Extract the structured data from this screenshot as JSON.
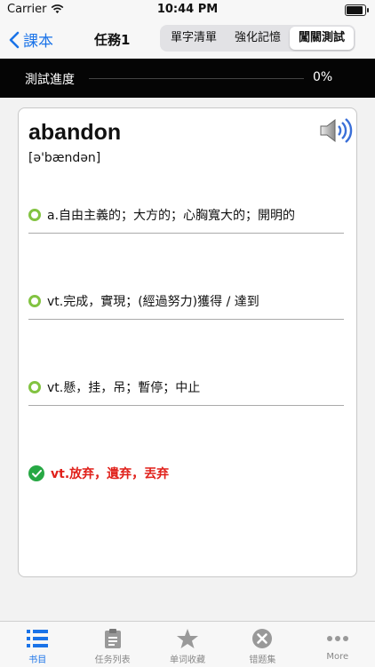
{
  "status": {
    "carrier": "Carrier",
    "time": "10:44 PM",
    "battery_level": 1.0
  },
  "navbar": {
    "back_label": "課本",
    "title": "任務1",
    "segments": [
      {
        "label": "單字清單",
        "active": false
      },
      {
        "label": "強化記憶",
        "active": false
      },
      {
        "label": "闖關測試",
        "active": true
      }
    ]
  },
  "progress": {
    "label": "測試進度",
    "value_text": "0%",
    "value": 0
  },
  "card": {
    "word": "abandon",
    "phonetic": "[ə'bændən]",
    "options": [
      {
        "text": "a.自由主義的；大方的；心胸寬大的；開明的",
        "correct": false
      },
      {
        "text": "vt.完成，實現；(經過努力)獲得 / 達到",
        "correct": false
      },
      {
        "text": "vt.懸，挂，吊；暫停；中止",
        "correct": false
      },
      {
        "text": "vt.放弃，遺弃，丟弃",
        "correct": true
      }
    ]
  },
  "tabs": [
    {
      "label": "书目",
      "icon": "list-icon",
      "active": true
    },
    {
      "label": "任务列表",
      "icon": "clipboard-icon",
      "active": false
    },
    {
      "label": "单词收藏",
      "icon": "star-icon",
      "active": false
    },
    {
      "label": "错题集",
      "icon": "x-circle-icon",
      "active": false
    },
    {
      "label": "More",
      "icon": "more-icon",
      "active": false
    }
  ],
  "colors": {
    "accent": "#1a73e8",
    "correct": "#e0201a",
    "check": "#27a844",
    "ring": "#82c341"
  }
}
